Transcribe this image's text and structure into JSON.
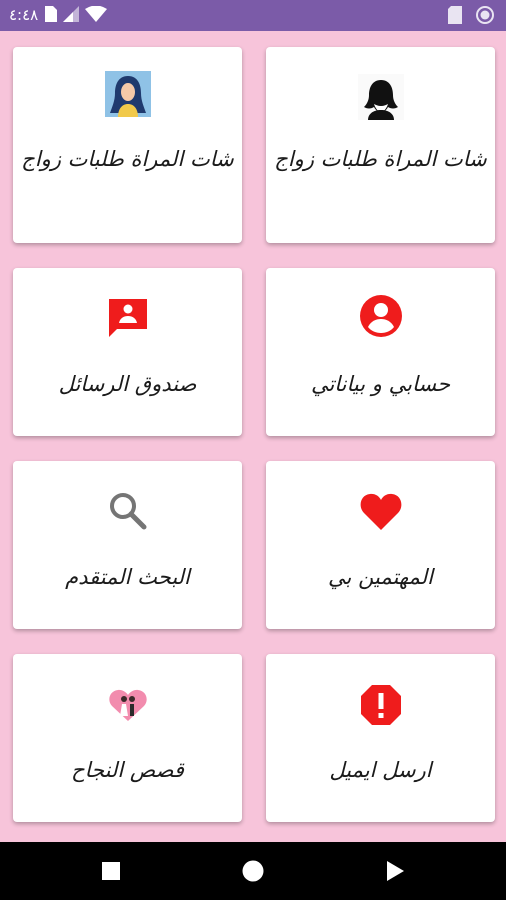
{
  "status_bar": {
    "time": "٤:٤٨"
  },
  "cards": [
    {
      "id": "chat-women-marriage-1",
      "label": "شات المراة طلبات زواج",
      "icon": "woman-silhouette-icon"
    },
    {
      "id": "chat-women-marriage-2",
      "label": "شات المراة طلبات زواج",
      "icon": "woman-avatar-icon"
    },
    {
      "id": "my-account",
      "label": "حسابي و بياناتي",
      "icon": "account-circle-icon"
    },
    {
      "id": "inbox",
      "label": "صندوق الرسائل",
      "icon": "message-person-icon"
    },
    {
      "id": "interested-in-me",
      "label": "المهتمين بي",
      "icon": "heart-icon"
    },
    {
      "id": "advanced-search",
      "label": "البحث المتقدم",
      "icon": "search-icon"
    },
    {
      "id": "send-email",
      "label": "ارسل ايميل",
      "icon": "alert-octagon-icon"
    },
    {
      "id": "success-stories",
      "label": "قصص النجاح",
      "icon": "couple-heart-icon"
    }
  ],
  "colors": {
    "status_bar": "#7b5ba8",
    "background": "#f7c4da",
    "accent_red": "#ef1c1c",
    "nav_bar": "#000000"
  }
}
